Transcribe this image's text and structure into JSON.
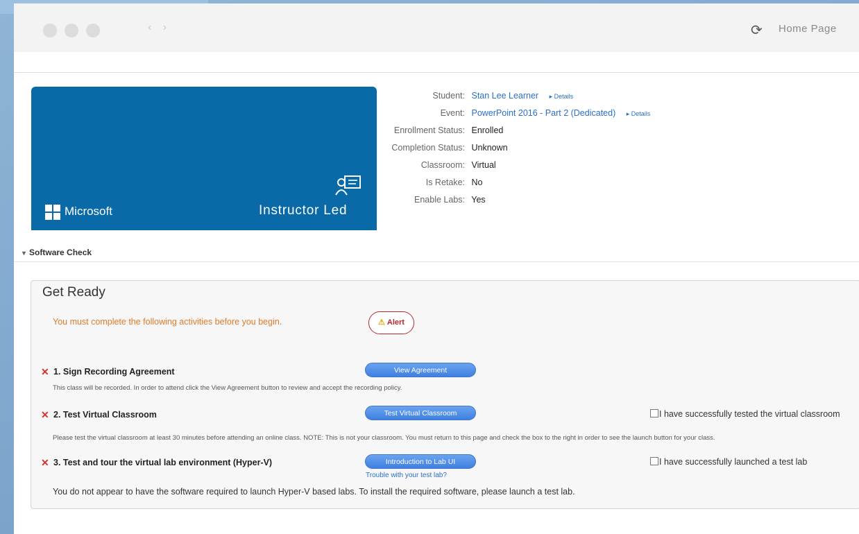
{
  "browser": {
    "nav_arrows": "‹ ›",
    "reload_icon": "⟳",
    "home_label": "Home Page"
  },
  "hero": {
    "brand": "Microsoft",
    "course_type": "Instructor Led",
    "bg_color": "#0a6aa7"
  },
  "details": {
    "student_label": "Student:",
    "student_value": "Stan Lee Learner",
    "student_more": "▸ Details",
    "event_label": "Event:",
    "event_value": "PowerPoint 2016 - Part 2 (Dedicated)",
    "event_more": "▸ Details",
    "enrollment_label": "Enrollment Status:",
    "enrollment_value": "Enrolled",
    "completion_label": "Completion Status:",
    "completion_value": "Unknown",
    "classroom_label": "Classroom:",
    "classroom_value": "Virtual",
    "retake_label": "Is Retake:",
    "retake_value": "No",
    "labs_label": "Enable Labs:",
    "labs_value": "Yes"
  },
  "software_check": {
    "label": "Software Check",
    "collapse_icon": "▾"
  },
  "get_ready": {
    "title": "Get Ready",
    "warning": "You must complete the following activities before you begin.",
    "alert_icon": "⚠",
    "alert_label": "Alert"
  },
  "steps": [
    {
      "title": "1. Sign Recording Agreement",
      "desc": "This class will be recorded. In order to attend click the View Agreement button to review and accept the recording policy.",
      "button": "View Agreement"
    },
    {
      "title": "2. Test Virtual Classroom",
      "desc": "Please test the virtual classroom at least 30 minutes before attending an online class. NOTE: This is not your classroom. You must return to this page and check the box to the right in order to see the launch button for your class.",
      "button": "Test Virtual Classroom",
      "checkbox": "I have successfully tested the virtual classroom"
    },
    {
      "title": "3. Test and tour the virtual lab environment (Hyper-V)",
      "button": "Introduction to Lab UI",
      "checkbox": "I have successfully launched a test lab",
      "link": "Trouble with your test lab?",
      "message": "You do not appear to have the software required to launch Hyper-V based labs. To install the required software, please launch a test lab."
    }
  ],
  "status_icon": "✕",
  "colors": {
    "link": "#2a6fc9",
    "warning": "#e07a2a",
    "error": "#d6312b",
    "button": "#4a88e6"
  }
}
